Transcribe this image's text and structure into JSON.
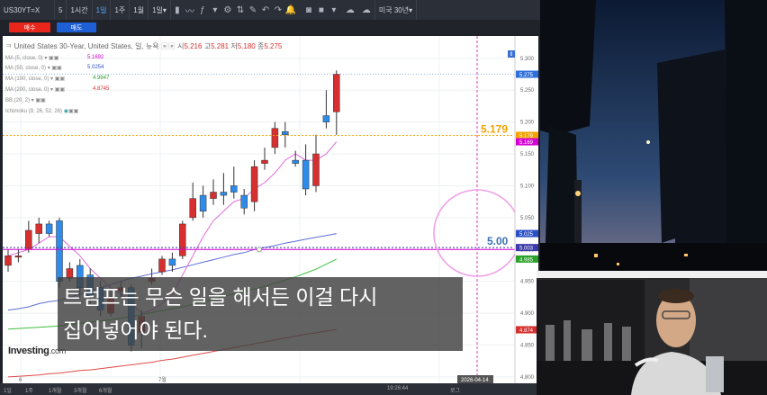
{
  "toolbar": {
    "symbol": "US30YT=X",
    "interval": "5",
    "timeframes": [
      "1시간",
      "1일",
      "1주",
      "1월",
      "1일"
    ],
    "selected_region": "미국 30년"
  },
  "trade": {
    "sell_label": "매수",
    "buy_label": "매도",
    "sell_color": "#e8261b",
    "buy_color": "#1f5fd6"
  },
  "chart_header": {
    "title": "United States 30-Year, United States, 일, 뉴욕",
    "open_label": "시",
    "open": "5.216",
    "high_label": "고",
    "high": "5.281",
    "low_label": "저",
    "low": "5.180",
    "close_label": "종",
    "close": "5.275"
  },
  "indicators": [
    {
      "name": "MA (5, close, 0)",
      "value": "5.1692",
      "color": "#d400d4"
    },
    {
      "name": "MA (50, close, 0)",
      "value": "5.0254",
      "color": "#2a4fc7"
    },
    {
      "name": "MA (100, close, 0)",
      "value": "4.9847",
      "color": "#2aa12a"
    },
    {
      "name": "MA (200, close, 0)",
      "value": "4.8745",
      "color": "#d62f2f"
    },
    {
      "name": "BB (20, 2)",
      "value": "",
      "color": "#888888"
    },
    {
      "name": "Ichimoku (9, 26, 52, 26)",
      "value": "",
      "color": "#888888"
    }
  ],
  "price_scale": {
    "ticks": [
      "5.300",
      "5.250",
      "5.200",
      "5.150",
      "5.100",
      "5.050",
      "5.000",
      "4.950",
      "4.900",
      "4.850",
      "4.800"
    ],
    "badges": [
      {
        "text": "5.275",
        "color": "#2f6fdc"
      },
      {
        "text": "5.179",
        "color": "#f5a300"
      },
      {
        "text": "5.169",
        "color": "#d400d4"
      },
      {
        "text": "5.025",
        "color": "#2a4fc7"
      },
      {
        "text": "5.003",
        "color": "#3a3aa8"
      },
      {
        "text": "4.985",
        "color": "#2aa12a"
      },
      {
        "text": "4.874",
        "color": "#d62f2f"
      }
    ]
  },
  "annotations": {
    "level_1": "5.179",
    "level_2": "5.00"
  },
  "chart_data": {
    "type": "candlestick",
    "ylim": [
      4.79,
      5.335
    ],
    "candles": [
      {
        "o": 4.975,
        "h": 5.0,
        "l": 4.965,
        "c": 4.99
      },
      {
        "o": 4.99,
        "h": 5.0,
        "l": 4.98,
        "c": 4.99
      },
      {
        "o": 5.0,
        "h": 5.045,
        "l": 4.995,
        "c": 5.03
      },
      {
        "o": 5.025,
        "h": 5.05,
        "l": 5.01,
        "c": 5.04
      },
      {
        "o": 5.04,
        "h": 5.045,
        "l": 5.02,
        "c": 5.025
      },
      {
        "o": 5.045,
        "h": 5.05,
        "l": 4.94,
        "c": 4.95
      },
      {
        "o": 4.955,
        "h": 4.98,
        "l": 4.95,
        "c": 4.97
      },
      {
        "o": 4.975,
        "h": 4.985,
        "l": 4.925,
        "c": 4.94
      },
      {
        "o": 4.96,
        "h": 4.97,
        "l": 4.915,
        "c": 4.925
      },
      {
        "o": 4.94,
        "h": 4.95,
        "l": 4.895,
        "c": 4.905
      },
      {
        "o": 4.9,
        "h": 4.935,
        "l": 4.895,
        "c": 4.925
      },
      {
        "o": 4.935,
        "h": 4.95,
        "l": 4.925,
        "c": 4.94
      },
      {
        "o": 4.94,
        "h": 4.945,
        "l": 4.84,
        "c": 4.85
      },
      {
        "o": 4.87,
        "h": 4.905,
        "l": 4.845,
        "c": 4.895
      },
      {
        "o": 4.95,
        "h": 4.97,
        "l": 4.945,
        "c": 4.955
      },
      {
        "o": 4.965,
        "h": 4.99,
        "l": 4.96,
        "c": 4.985
      },
      {
        "o": 4.985,
        "h": 4.995,
        "l": 4.965,
        "c": 4.975
      },
      {
        "o": 4.99,
        "h": 5.045,
        "l": 4.985,
        "c": 5.04
      },
      {
        "o": 5.05,
        "h": 5.105,
        "l": 5.045,
        "c": 5.08
      },
      {
        "o": 5.085,
        "h": 5.1,
        "l": 5.05,
        "c": 5.06
      },
      {
        "o": 5.08,
        "h": 5.11,
        "l": 5.07,
        "c": 5.09
      },
      {
        "o": 5.09,
        "h": 5.12,
        "l": 5.07,
        "c": 5.085
      },
      {
        "o": 5.1,
        "h": 5.13,
        "l": 5.08,
        "c": 5.09
      },
      {
        "o": 5.085,
        "h": 5.095,
        "l": 5.055,
        "c": 5.065
      },
      {
        "o": 5.075,
        "h": 5.14,
        "l": 5.06,
        "c": 5.13
      },
      {
        "o": 5.135,
        "h": 5.16,
        "l": 5.125,
        "c": 5.14
      },
      {
        "o": 5.16,
        "h": 5.2,
        "l": 5.15,
        "c": 5.19
      },
      {
        "o": 5.185,
        "h": 5.2,
        "l": 5.16,
        "c": 5.18
      },
      {
        "o": 5.14,
        "h": 5.155,
        "l": 5.13,
        "c": 5.135
      },
      {
        "o": 5.14,
        "h": 5.165,
        "l": 5.085,
        "c": 5.095
      },
      {
        "o": 5.1,
        "h": 5.18,
        "l": 5.09,
        "c": 5.15
      },
      {
        "o": 5.21,
        "h": 5.25,
        "l": 5.19,
        "c": 5.2
      },
      {
        "o": 5.216,
        "h": 5.281,
        "l": 5.18,
        "c": 5.275
      }
    ],
    "ma5": [
      4.99,
      4.995,
      5.0,
      5.01,
      5.02,
      5.02,
      5.005,
      4.99,
      4.97,
      4.955,
      4.94,
      4.93,
      4.915,
      4.9,
      4.905,
      4.915,
      4.93,
      4.96,
      4.99,
      5.02,
      5.045,
      5.06,
      5.075,
      5.08,
      5.095,
      5.105,
      5.12,
      5.14,
      5.15,
      5.14,
      5.14,
      5.15,
      5.169
    ],
    "ma50": [
      4.905,
      4.907,
      4.91,
      4.915,
      4.918,
      4.92,
      4.925,
      4.93,
      4.935,
      4.94,
      4.945,
      4.95,
      4.955,
      4.958,
      4.962,
      4.965,
      4.968,
      4.972,
      4.976,
      4.98,
      4.984,
      4.988,
      4.992,
      4.995,
      5.0,
      5.003,
      5.006,
      5.01,
      5.013,
      5.016,
      5.019,
      5.022,
      5.025
    ],
    "ma100": [
      4.875,
      4.876,
      4.877,
      4.878,
      4.879,
      4.88,
      4.882,
      4.884,
      4.886,
      4.888,
      4.89,
      4.892,
      4.895,
      4.898,
      4.901,
      4.904,
      4.907,
      4.91,
      4.914,
      4.918,
      4.922,
      4.926,
      4.93,
      4.934,
      4.938,
      4.942,
      4.947,
      4.952,
      4.957,
      4.963,
      4.969,
      4.977,
      4.985
    ],
    "ma200": [
      4.8,
      4.801,
      4.802,
      4.803,
      4.805,
      4.806,
      4.808,
      4.81,
      4.811,
      4.813,
      4.815,
      4.817,
      4.819,
      4.821,
      4.823,
      4.826,
      4.828,
      4.831,
      4.834,
      4.837,
      4.84,
      4.843,
      4.846,
      4.849,
      4.852,
      4.855,
      4.858,
      4.861,
      4.864,
      4.867,
      4.869,
      4.872,
      4.874
    ],
    "up_color": "#d62f2f",
    "down_color": "#2e8bea"
  },
  "x_axis": {
    "labels": [
      "6",
      "7월"
    ],
    "current_date": "2026-04-14"
  },
  "bottom_bar": {
    "ranges": [
      "1일",
      "1주",
      "1개월",
      "3개월",
      "6개월"
    ],
    "time": "19:26:44",
    "scale_label": "로그"
  },
  "subtitle": {
    "line1": "트럼프는 무슨 일을 해서든 이걸 다시",
    "line2": "집어넣어야 된다."
  },
  "branding": {
    "logo": "Investing",
    "logo_suffix": ".com"
  }
}
